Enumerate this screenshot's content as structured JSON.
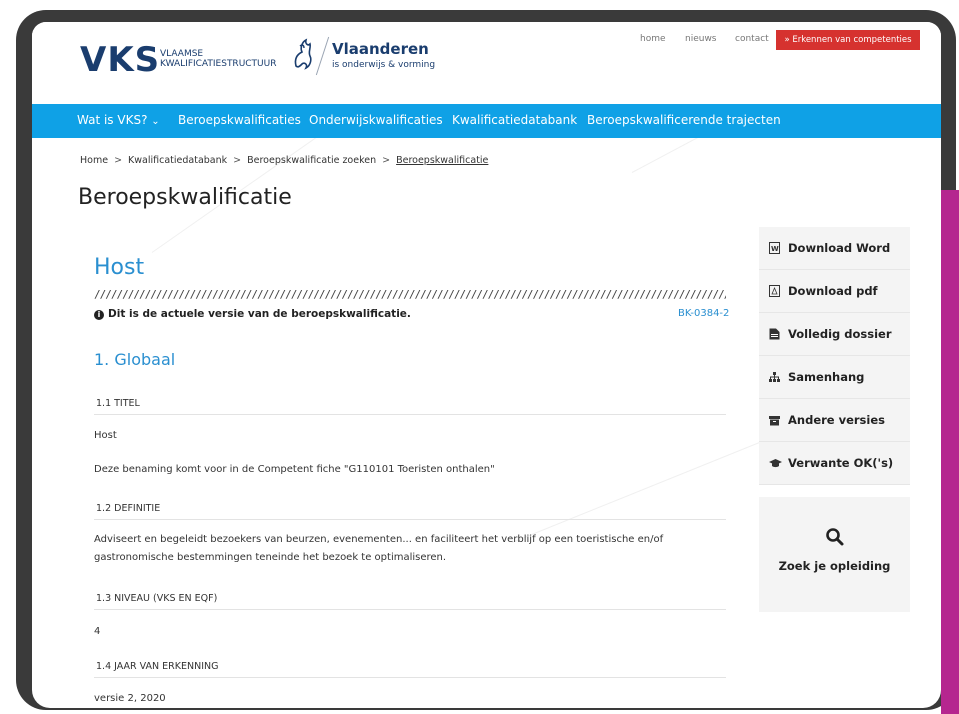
{
  "header": {
    "logo_vks": "VKS",
    "logo_sub_line1": "VLAAMSE",
    "logo_sub_line2": "KWALIFICATIESTRUCTUUR",
    "vlaanderen_title": "Vlaanderen",
    "vlaanderen_sub": "is onderwijs & vorming",
    "top_links": [
      "home",
      "nieuws",
      "contact"
    ],
    "cta_label": "» Erkennen van competenties"
  },
  "nav": {
    "items": [
      "Wat is VKS?",
      "Beroepskwalificaties",
      "Onderwijskwalificaties",
      "Kwalificatiedatabank",
      "Beroepskwalificerende trajecten"
    ]
  },
  "breadcrumb": {
    "items": [
      "Home",
      "Kwalificatiedatabank",
      "Beroepskwalificatie zoeken",
      "Beroepskwalificatie"
    ],
    "separator": ">"
  },
  "page": {
    "title": "Beroepskwalificatie",
    "host_title": "Host",
    "slashes": "//////////////////////////////////////////////////////////////////////////////////////////////////////////////////////////////////////",
    "current_version_note": "Dit is de actuele versie van de beroepskwalificatie.",
    "code": "BK-0384-2",
    "section_heading": "1. Globaal",
    "sections": [
      {
        "label": "1.1 TITEL",
        "lines": [
          "Host",
          "Deze benaming komt voor in de Competent fiche \"G110101 Toeristen onthalen\""
        ]
      },
      {
        "label": "1.2 DEFINITIE",
        "lines": [
          "Adviseert en begeleidt bezoekers van beurzen, evenementen... en faciliteert het verblijf op een toeristische en/of gastronomische bestemmingen teneinde het bezoek te optimaliseren."
        ]
      },
      {
        "label": "1.3 NIVEAU (VKS EN EQF)",
        "lines": [
          "4"
        ]
      },
      {
        "label": "1.4 JAAR VAN ERKENNING",
        "lines": [
          "versie 2, 2020"
        ]
      }
    ]
  },
  "sidebar": {
    "items": [
      {
        "label": "Download Word",
        "icon": "word-file-icon"
      },
      {
        "label": "Download pdf",
        "icon": "pdf-file-icon"
      },
      {
        "label": "Volledig dossier",
        "icon": "document-icon"
      },
      {
        "label": "Samenhang",
        "icon": "sitemap-icon"
      },
      {
        "label": "Andere versies",
        "icon": "archive-icon"
      },
      {
        "label": "Verwante OK('s)",
        "icon": "graduation-cap-icon"
      }
    ],
    "search_label": "Zoek je opleiding"
  },
  "colors": {
    "nav_bg": "#0fa1e6",
    "brand_navy": "#1a3d6e",
    "accent_blue": "#2a8fd0",
    "cta_red": "#d6322f",
    "magenta_edge": "#b5268f"
  }
}
